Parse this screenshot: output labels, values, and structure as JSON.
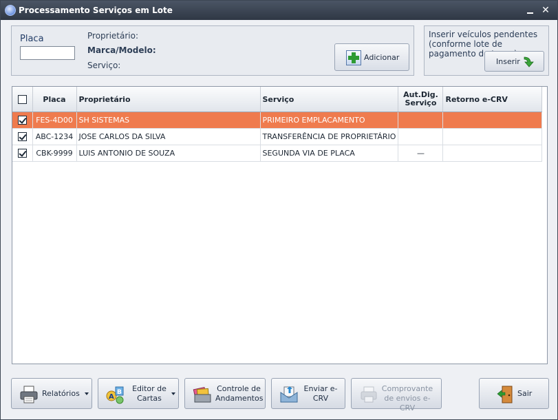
{
  "window": {
    "title": "Processamento Serviços em Lote"
  },
  "form": {
    "placa_label": "Placa",
    "placa_value": "",
    "proprietario_label": "Proprietário:",
    "marca_label": "Marca/Modelo:",
    "servico_label": "Serviço:",
    "add_button": "Adicionar"
  },
  "insert_panel": {
    "text": "Inserir veículos pendentes (conforme lote de pagamento de taxas)",
    "button": "Inserir"
  },
  "grid": {
    "headers": {
      "placa": "Placa",
      "proprietario": "Proprietário",
      "servico": "Serviço",
      "aut": "Aut.Dig. Serviço",
      "retorno": "Retorno e-CRV"
    },
    "header_checkbox_checked": false,
    "rows": [
      {
        "checked": true,
        "placa": "FES-4D00",
        "proprietario": "SH SISTEMAS",
        "servico": "PRIMEIRO EMPLACAMENTO",
        "aut": "",
        "retorno": "",
        "selected": true
      },
      {
        "checked": true,
        "placa": "ABC-1234",
        "proprietario": "JOSE CARLOS DA SILVA",
        "servico": "TRANSFERÊNCIA DE PROPRIETÁRIO",
        "aut": "",
        "retorno": "",
        "selected": false
      },
      {
        "checked": true,
        "placa": "CBK-9999",
        "proprietario": "LUIS ANTONIO DE SOUZA",
        "servico": "SEGUNDA VIA DE PLACA",
        "aut": "—",
        "retorno": "",
        "selected": false
      }
    ]
  },
  "toolbar": {
    "relatorios": "Relatórios",
    "editor_cartas": "Editor de Cartas",
    "controle_andamentos": "Controle de Andamentos",
    "enviar_ecrv": "Enviar e-CRV",
    "comprovante": "Comprovante de envios e-CRV",
    "sair": "Sair"
  },
  "colors": {
    "selected_row": "#ef7b4e",
    "titlebar": "#3a4350",
    "accent_green": "#2e9b33"
  },
  "icons": [
    "app-icon",
    "add-icon",
    "green-arrow-icon",
    "printer-icon",
    "letters-icon",
    "folders-icon",
    "send-icon",
    "printer-disabled-icon",
    "exit-door-icon"
  ]
}
